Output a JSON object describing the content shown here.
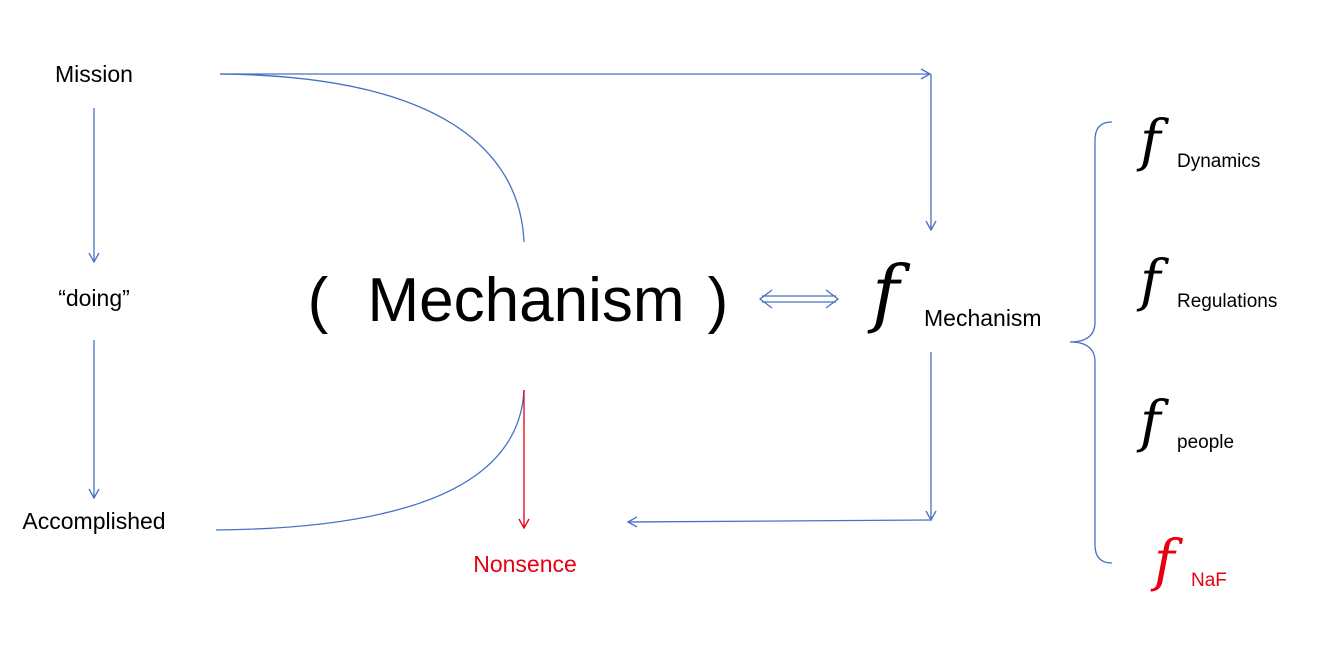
{
  "nodes": {
    "mission": "Mission",
    "doing": "“doing”",
    "accomplished": "Accomplished",
    "mechanism_open": "(",
    "mechanism": "Mechanism",
    "mechanism_close": ")",
    "nonsence": "Nonsence",
    "f_symbol": "f",
    "f_mechanism_sub": "Mechanism"
  },
  "components": [
    {
      "symbol": "f",
      "sub": "Dynamics"
    },
    {
      "symbol": "f",
      "sub": "Regulations"
    },
    {
      "symbol": "f",
      "sub": "people"
    },
    {
      "symbol": "f",
      "sub": "NaF"
    }
  ],
  "colors": {
    "line": "#4472c4",
    "alert": "#e60012",
    "text": "#000000"
  }
}
